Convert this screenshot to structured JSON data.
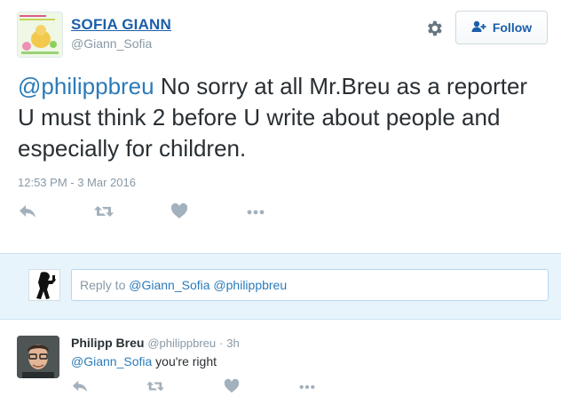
{
  "tweet": {
    "display_name": "SOFIA GIANN",
    "screen_name": "@Giann_Sofia",
    "follow_label": "Follow",
    "text_mention": "@philippbreu",
    "text_body": " No sorry at all Mr.Breu as a reporter U must think 2 before U write about people and especially for children.",
    "timestamp": "12:53 PM - 3 Mar 2016",
    "actions": [
      "reply-icon",
      "retweet-icon",
      "like-icon",
      "more-icon"
    ]
  },
  "reply_box": {
    "prefix": "Reply to ",
    "mention1": "@Giann_Sofia",
    "mention2": "@philippbreu"
  },
  "reply": {
    "name": "Philipp Breu",
    "handle": "@philippbreu",
    "time": "3h",
    "mention": "@Giann_Sofia",
    "text": " you're right",
    "actions": [
      "reply-icon",
      "retweet-icon",
      "like-icon",
      "more-icon"
    ]
  },
  "colors": {
    "link": "#2b7bb9",
    "name": "#1b5ea8",
    "muted": "#8899a6",
    "icon": "#a3b1bd",
    "reply_bg": "#e8f4fb"
  }
}
